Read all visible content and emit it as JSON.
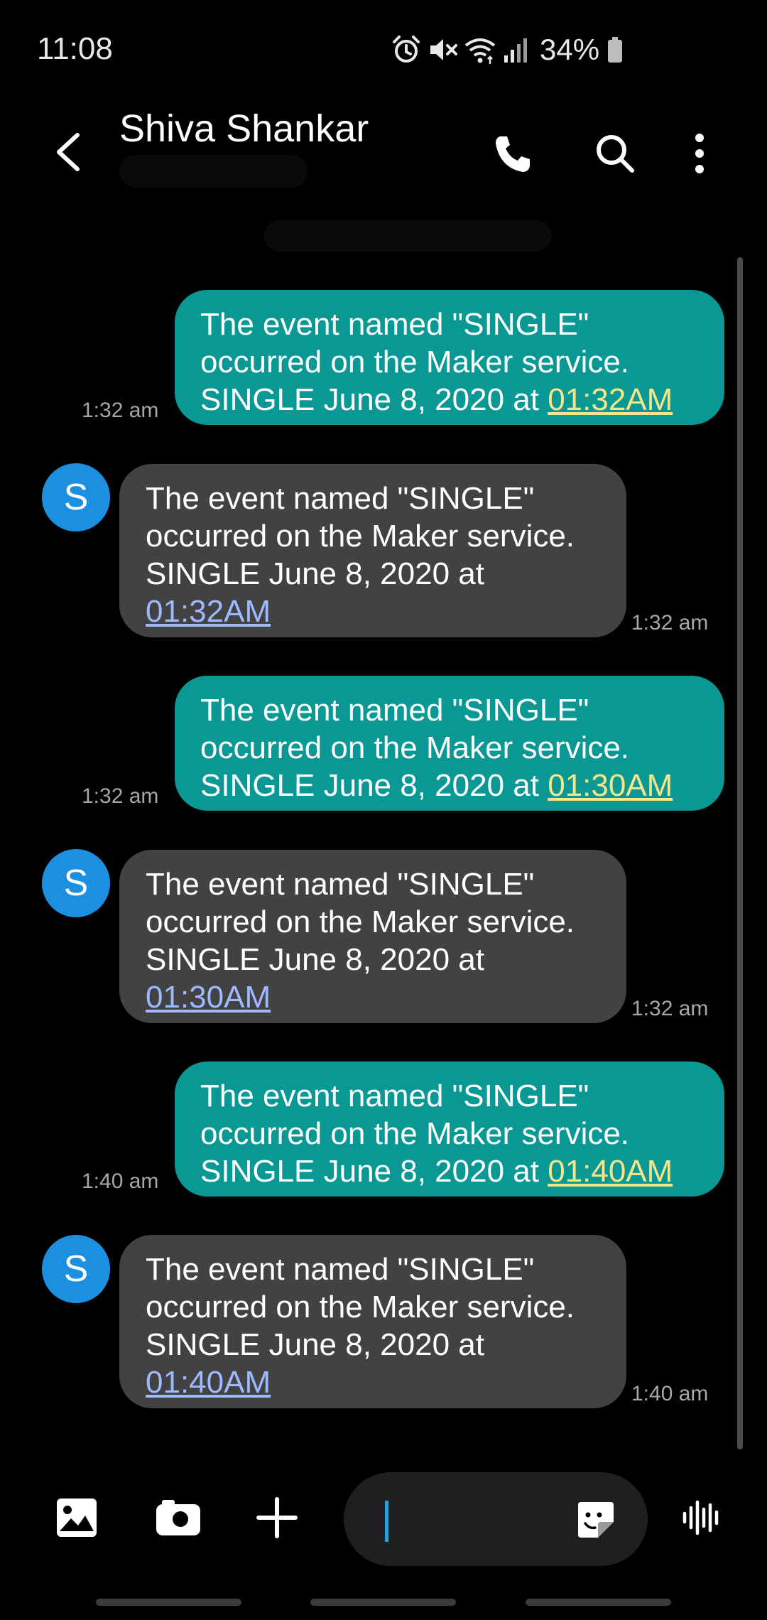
{
  "status_bar": {
    "time": "11:08",
    "battery": "34%",
    "icons": [
      "alarm-icon",
      "mute-icon",
      "wifi-icon",
      "signal-icon",
      "battery-icon"
    ]
  },
  "header": {
    "contact_name": "Shiva Shankar",
    "actions": [
      "back-icon",
      "phone-icon",
      "search-icon",
      "more-vertical-icon"
    ]
  },
  "colors": {
    "background": "#000000",
    "outgoing_bubble": "#0a9894",
    "incoming_bubble": "#424242",
    "avatar": "#1b8fe0",
    "outgoing_link": "#f3e58a",
    "incoming_link": "#9fb9ff"
  },
  "messages": [
    {
      "direction": "outgoing",
      "line1": "The event named \"SINGLE\"",
      "line2": "occurred on the Maker service.",
      "line3": "SINGLE June 8, 2020 at ",
      "link": "01:32AM",
      "time": "1:32 am"
    },
    {
      "direction": "incoming",
      "avatar": "S",
      "line1": "The event named \"SINGLE\"",
      "line2": "occurred on the Maker service.",
      "line3": "SINGLE June 8, 2020 at",
      "link": "01:32AM",
      "time": "1:32 am"
    },
    {
      "direction": "outgoing",
      "line1": "The event named \"SINGLE\"",
      "line2": "occurred on the Maker service.",
      "line3": "SINGLE June 8, 2020 at ",
      "link": "01:30AM",
      "time": "1:32 am"
    },
    {
      "direction": "incoming",
      "avatar": "S",
      "line1": "The event named \"SINGLE\"",
      "line2": "occurred on the Maker service.",
      "line3": "SINGLE June 8, 2020 at",
      "link": "01:30AM",
      "time": "1:32 am"
    },
    {
      "direction": "outgoing",
      "line1": "The event named \"SINGLE\"",
      "line2": "occurred on the Maker service.",
      "line3": "SINGLE June 8, 2020 at ",
      "link": "01:40AM",
      "time": "1:40 am"
    },
    {
      "direction": "incoming",
      "avatar": "S",
      "line1": "The event named \"SINGLE\"",
      "line2": "occurred on the Maker service.",
      "line3": "SINGLE June 8, 2020 at",
      "link": "01:40AM",
      "time": "1:40 am"
    }
  ],
  "composer": {
    "placeholder": "",
    "buttons": [
      "gallery-icon",
      "camera-icon",
      "plus-icon",
      "sticker-icon",
      "voice-icon"
    ]
  }
}
